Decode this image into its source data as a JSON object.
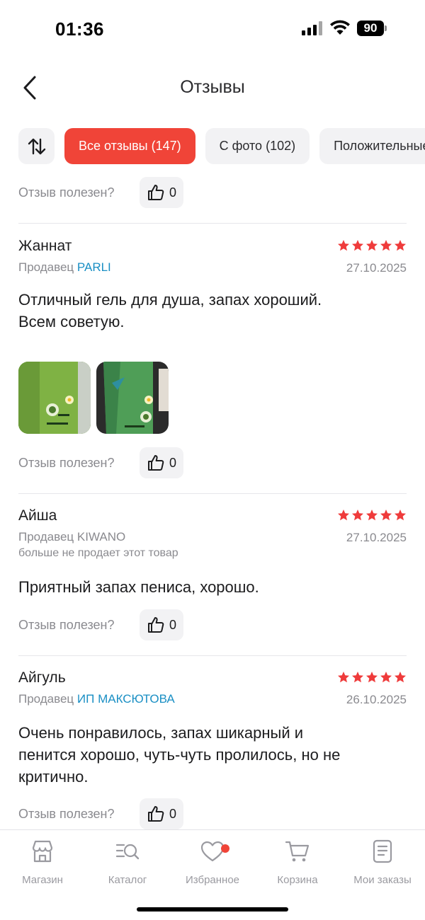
{
  "status_bar": {
    "time": "01:36",
    "battery": "90"
  },
  "header": {
    "title": "Отзывы"
  },
  "filters": {
    "chips": [
      {
        "label": "Все отзывы (147)",
        "active": true
      },
      {
        "label": "С фото (102)",
        "active": false
      },
      {
        "label": "Положительные",
        "active": false
      }
    ]
  },
  "helpful_label": "Отзыв полезен?",
  "reviews_top_helpful_count": "0",
  "reviews": [
    {
      "author": "Жаннат",
      "rating": 5,
      "seller_prefix": "Продавец",
      "seller": "PARLI",
      "seller_linked": true,
      "date": "27.10.2025",
      "seller_note": "",
      "text_lines": [
        "Отличный гель для душа, запах хороший.",
        "Всем советую."
      ],
      "photo_count": 2,
      "helpful_count": "0"
    },
    {
      "author": "Айша",
      "rating": 5,
      "seller_prefix": "Продавец",
      "seller": "KIWANO",
      "seller_linked": false,
      "date": "27.10.2025",
      "seller_note": "больше не продает этот товар",
      "text_lines": [
        "Приятный запах пениса, хорошо."
      ],
      "photo_count": 0,
      "helpful_count": "0"
    },
    {
      "author": "Айгуль",
      "rating": 5,
      "seller_prefix": "Продавец",
      "seller": "ИП МАКСЮТОВА",
      "seller_linked": true,
      "date": "26.10.2025",
      "seller_note": "",
      "text_lines": [
        "Очень понравилось, запах шикарный и",
        "пенится хорошо, чуть-чуть пролилось, но не",
        "критично."
      ],
      "photo_count": 0,
      "helpful_count": "0"
    }
  ],
  "tabbar": {
    "tabs": [
      {
        "label": "Магазин",
        "icon": "store-icon"
      },
      {
        "label": "Каталог",
        "icon": "catalog-search-icon"
      },
      {
        "label": "Избранное",
        "icon": "heart-icon",
        "badge_dot": true
      },
      {
        "label": "Корзина",
        "icon": "cart-icon"
      },
      {
        "label": "Мои заказы",
        "icon": "orders-icon"
      }
    ]
  },
  "colors": {
    "accent": "#f04438",
    "star": "#ef3b3b",
    "link": "#1a8fc4",
    "muted": "#8a8a8f",
    "chip_bg": "#f2f2f4"
  }
}
